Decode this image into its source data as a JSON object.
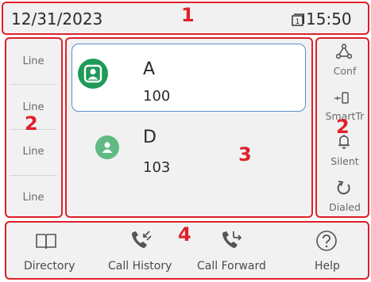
{
  "header": {
    "date": "12/31/2023",
    "time": "15:50",
    "calendar_day": "1"
  },
  "annotations": {
    "header": "1",
    "line_keys": "2",
    "softkeys": "2",
    "contacts": "3",
    "bottom_bar": "4"
  },
  "line_keys": [
    {
      "label": "Line"
    },
    {
      "label": "Line"
    },
    {
      "label": "Line"
    },
    {
      "label": "Line"
    }
  ],
  "contacts": [
    {
      "name": "A",
      "extension": "100",
      "status_color": "#1f9a57",
      "selected": true
    },
    {
      "name": "D",
      "extension": "103",
      "status_color": "#5fba84",
      "selected": false
    }
  ],
  "softkeys": [
    {
      "label": "Conf",
      "icon": "conference-icon"
    },
    {
      "label": "SmartTr",
      "icon": "smart-transfer-icon"
    },
    {
      "label": "Silent",
      "icon": "bell-icon"
    },
    {
      "label": "Dialed",
      "icon": "redial-icon"
    }
  ],
  "bottom_bar": [
    {
      "label": "Directory",
      "icon": "book-icon"
    },
    {
      "label": "Call History",
      "icon": "call-history-icon"
    },
    {
      "label": "Call Forward",
      "icon": "call-forward-icon"
    },
    {
      "label": "Help",
      "icon": "help-icon"
    }
  ],
  "colors": {
    "annotation": "#e0202a",
    "selection_border": "#5b8ec9",
    "panel_bg": "#f1f1f1"
  }
}
